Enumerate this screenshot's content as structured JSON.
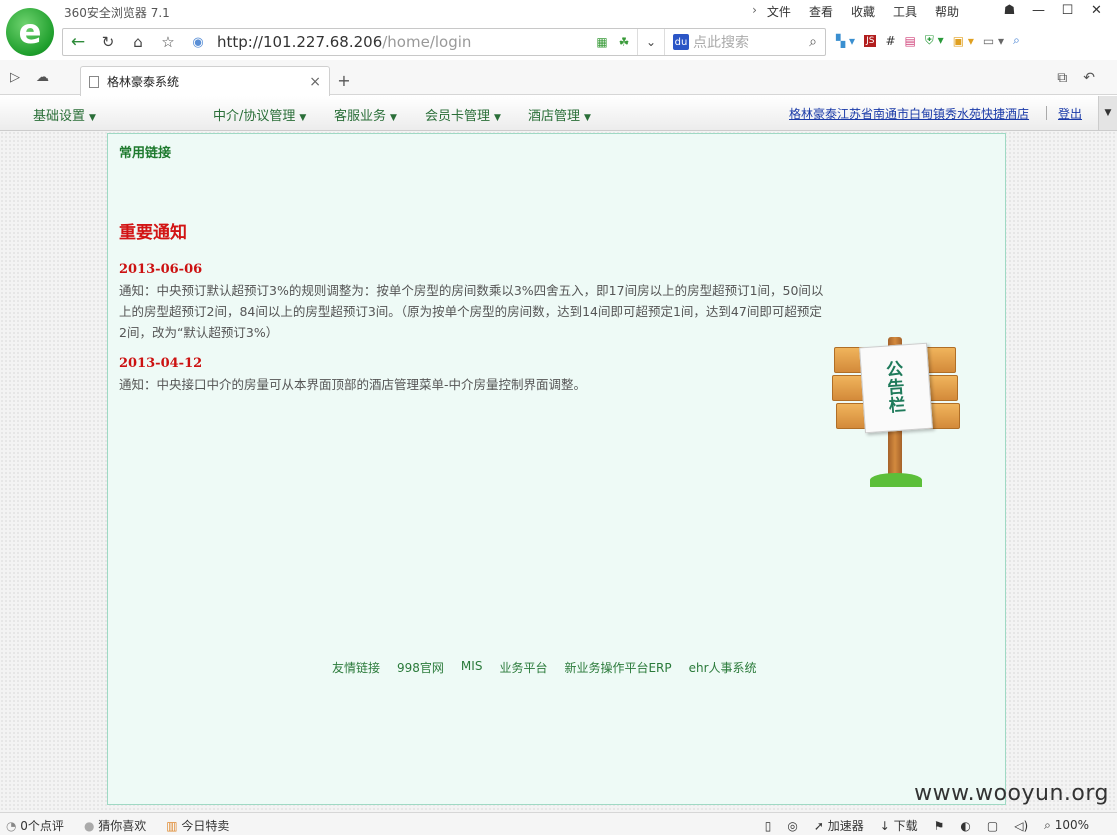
{
  "browser": {
    "app_title": "360安全浏览器 7.1",
    "menu": [
      "文件",
      "查看",
      "收藏",
      "工具",
      "帮助"
    ],
    "url_host": "http://101.227.68.206",
    "url_path": "/home/login",
    "search_placeholder": "点此搜索",
    "tab_title": "格林豪泰系统",
    "tab_close": "×",
    "new_tab": "+"
  },
  "site_nav": {
    "items": [
      {
        "label": "基础设置"
      },
      {
        "label": "中介/协议管理"
      },
      {
        "label": "客服业务"
      },
      {
        "label": "会员卡管理"
      },
      {
        "label": "酒店管理"
      }
    ],
    "hotel_name": "格林豪泰江苏省南通市白甸镇秀水苑快捷酒店",
    "logout": "登出"
  },
  "content": {
    "common_links_title": "常用链接",
    "notice_title": "重要通知",
    "notices": [
      {
        "date": "2013-06-06",
        "text": "通知：中央预订默认超预订3%的规则调整为：按单个房型的房间数乘以3%四舍五入，即17间房以上的房型超预订1间，50间以上的房型超预订2间，84间以上的房型超预订3间。（原为按单个房型的房间数，达到14间即可超预定1间，达到47间即可超预定2间，改为“默认超预订3%）"
      },
      {
        "date": "2013-04-12",
        "text": "通知：中央接口中介的房量可从本界面顶部的酒店管理菜单-中介房量控制界面调整。"
      }
    ],
    "signboard_text": [
      "公",
      "告",
      "栏"
    ],
    "footer_links": [
      "友情链接",
      "998官网",
      "MIS",
      "业务平台",
      "新业务操作平台ERP",
      "ehr人事系统"
    ]
  },
  "status_bar": {
    "reviews": "0个点评",
    "guess": "猜你喜欢",
    "deals": "今日特卖",
    "accelerator": "加速器",
    "download": "下载",
    "zoom": "100%"
  },
  "watermark": "www.wooyun.org"
}
